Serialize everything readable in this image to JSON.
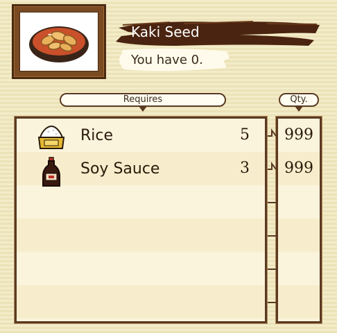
{
  "item": {
    "name": "Kaki Seed",
    "owned_text": "You have 0.",
    "icon": "kaki-seed-bowl-icon"
  },
  "requires_label": "Requires",
  "qty_label": "Qty.",
  "ingredients": [
    {
      "name": "Rice",
      "required": "5",
      "qty": "999",
      "icon": "rice-bag-icon"
    },
    {
      "name": "Soy Sauce",
      "required": "3",
      "qty": "999",
      "icon": "soy-sauce-bottle-icon"
    }
  ],
  "colors": {
    "frame": "#5a3a22",
    "banner": "#4a2410",
    "background": "#f3ecc9"
  }
}
